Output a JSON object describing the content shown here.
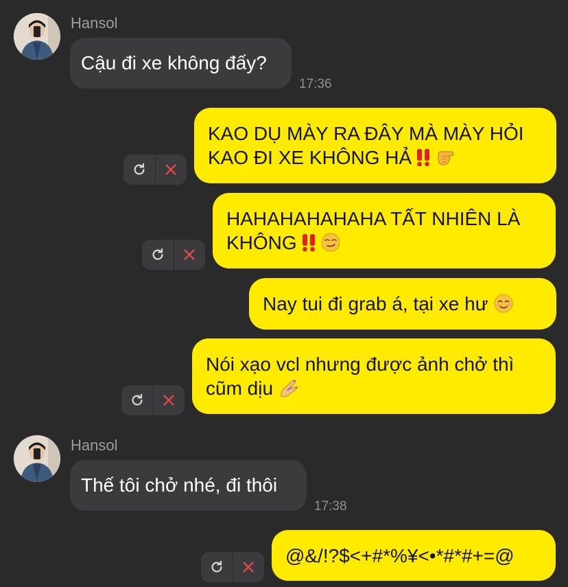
{
  "chat": {
    "messages": [
      {
        "type": "incoming",
        "sender": "Hansol",
        "text": "Cậu đi xe không đấy?",
        "time": "17:36"
      },
      {
        "type": "outgoing",
        "lines": [
          "KAO DỤ MÀY RA ĐÂY MÀ MÀY HỎI",
          "KAO ĐI XE KHÔNG HẢ"
        ],
        "emojis": [
          "double-exclamation-icon",
          "backhand-index-pointing-icon"
        ]
      },
      {
        "type": "outgoing",
        "lines": [
          "HAHAHAHAHAHA TẤT NHIÊN LÀ",
          "KHÔNG"
        ],
        "emojis": [
          "double-exclamation-icon",
          "smirking-face-icon"
        ]
      },
      {
        "type": "outgoing",
        "lines": [
          "Nay tui đi grab á, tại xe hư"
        ],
        "emojis": [
          "smiling-face-icon"
        ]
      },
      {
        "type": "outgoing",
        "lines": [
          "Nói xạo vcl nhưng được ảnh chở thì",
          "cũm dịu"
        ],
        "emojis": [
          "nail-polish-icon"
        ]
      },
      {
        "type": "incoming",
        "sender": "Hansol",
        "text": "Thế tôi chở nhé, đi thôi",
        "time": "17:38"
      },
      {
        "type": "outgoing",
        "lines": [
          "@&/!?$<+#*%¥<•*#*#+=@"
        ],
        "emojis": []
      }
    ]
  },
  "colors": {
    "background": "#2a2a2b",
    "incoming_bubble": "#3b3b3d",
    "outgoing_bubble": "#ffeb00",
    "retry": "#d8d8d8",
    "cancel": "#e5484d"
  }
}
